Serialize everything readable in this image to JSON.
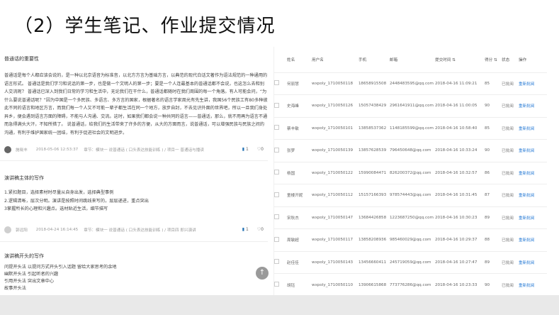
{
  "slide_title": "（2）学生笔记、作业提交情况",
  "notes": [
    {
      "title": "普通话的重要性",
      "body": "普通话是每个人都应该会说的，是一种以北京语音为标准音，以北方方言为基础方言，以典范的现代白话文著作为语法规范的一种通用的语言形式。 普通话是我们学习和说话的第一步，也是做一个文明人的第一步；要是一个人连最基本的普通话都不会说，也这怎么去和别人交流呢？ 普通话已深入到我们日常的学习和生活中，无论我们在干什么，普通话都随时在我们周围的每一个角落。有人可能会问，“为什么要说普通话呢？”因为中国是一个多民族、多语言、多方言的国家，根据著名的语言学家周光有先生讲，我国56个民族工有80多种彼此不同的语言和地区方言，而我们每一个人又不可能一辈子都生活在同一个地方，放步自封，不去见识外面的世界吧，所以一旦我们身处异乡，便会遇到语言方面的障碍，不能与人沟通、交流。这时，如果我们都会说一种共同的语言——普通话，那么，就不用再为语言不通而急得满头大汗，不知所措了。 说普通话，给我们的生活带来了许多的方便，从大的方面而言，说普通话，可以增强民族与民族之间的沟通，有利于维护国家统一团结，有利于促进社会的文明进步。",
      "author": "施晓丰",
      "time": "2018-05-06 12:53:37",
      "tags": "章节：模块一 说普通话 ( 口头表达技能训练 ) / 项目一 普通话与播读",
      "likes": "1",
      "comments": "0"
    },
    {
      "title": "演讲稿主体的写作",
      "body_lines": [
        "1.紧扣题目，选择素材时尽量从自身出发，选择典型事例",
        "2.逻辑清晰，层次分明。演讲是按照时间跳线来写的，层层递进，重点突出",
        "3掌握所长的心理和兴趣点。选材贴近生活，细节描写"
      ],
      "author": "郭远阳",
      "time": "2018-04-24 16:14:45",
      "tags": "章节：模块一 说普通话 ( 口头表达技能训练 ) / 项目四 即兴演讲",
      "likes": "1",
      "comments": "0"
    },
    {
      "title": "演讲稿开头的写作",
      "body_lines": [
        "问提开头法 以提问方式开头引入话题 留给大家思考的余地",
        "幽默开头法 引起听者的兴趣",
        "引用开头法 突出文章中心",
        "故事开头法"
      ]
    }
  ],
  "table": {
    "columns": [
      "",
      "姓名",
      "用户名",
      "手机",
      "邮箱",
      "提交时间",
      "得分",
      "状态",
      "操作"
    ],
    "rows": [
      {
        "name": "何丽慧",
        "username": "wxpoly_1710050118",
        "phone": "18658915508",
        "email": "2448483595@qq.com",
        "time": "2018-04-16 11:09:21",
        "score": "85",
        "status": "已批阅",
        "action": "重新批阅"
      },
      {
        "name": "史海峰",
        "username": "wxpoly_1710050126",
        "phone": "15057438429",
        "email": "2961641911@qq.com",
        "time": "2018-04-16 11:00:05",
        "score": "90",
        "status": "已批阅",
        "action": "重新批阅"
      },
      {
        "name": "蔡丰敏",
        "username": "wxpoly_1710050101",
        "phone": "13858537362",
        "email": "1148185599@qq.com",
        "time": "2018-04-16 10:58:40",
        "score": "85",
        "status": "已批阅",
        "action": "重新批阅"
      },
      {
        "name": "张梦",
        "username": "wxpoly_1710050139",
        "phone": "13857628539",
        "email": "796450648@qq.com",
        "time": "2018-04-16 10:33:24",
        "score": "90",
        "status": "已批阅",
        "action": "重新批阅"
      },
      {
        "name": "杨国",
        "username": "wxpoly_1710050122",
        "phone": "15990084471",
        "email": "826200372@qq.com",
        "time": "2018-04-16 10:32:57",
        "score": "86",
        "status": "已批阅",
        "action": "重新批阅"
      },
      {
        "name": "童楼开妮",
        "username": "wxpoly_1710050112",
        "phone": "15157166393",
        "email": "978574443@qq.com",
        "time": "2018-04-16 10:31:45",
        "score": "87",
        "status": "已批阅",
        "action": "重新批阅"
      },
      {
        "name": "宋秋杰",
        "username": "wxpoly_1710050147",
        "phone": "13684426858",
        "email": "1223687250@qq.com",
        "time": "2018-04-16 10:30:23",
        "score": "89",
        "status": "已批阅",
        "action": "重新批阅"
      },
      {
        "name": "周敏超",
        "username": "wxpoly_1710050117",
        "phone": "13858208936",
        "email": "985460029@qq.com",
        "time": "2018-04-16 10:29:37",
        "score": "88",
        "status": "已批阅",
        "action": "重新批阅"
      },
      {
        "name": "赵佳佳",
        "username": "wxpoly_1710050143",
        "phone": "13456660411",
        "email": "245719059@qq.com",
        "time": "2018-04-16 10:27:47",
        "score": "89",
        "status": "已批阅",
        "action": "重新批阅"
      },
      {
        "name": "胡钰",
        "username": "wxpoly_1710050110",
        "phone": "13906615868",
        "email": "773776286@qq.com",
        "time": "2018-04-16 10:23:33",
        "score": "90",
        "status": "已批阅",
        "action": "重新批阅"
      }
    ]
  }
}
